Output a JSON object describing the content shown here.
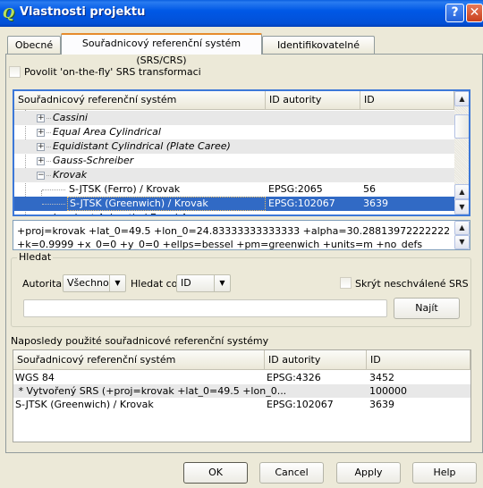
{
  "window": {
    "title": "Vlastnosti projektu",
    "help_button": "?",
    "close_button": "✕"
  },
  "tabs": [
    {
      "label": "Obecné",
      "active": false
    },
    {
      "label": "Souřadnicový referenční systém (SRS/CRS)",
      "active": true
    },
    {
      "label": "Identifikovatelné vrstvy",
      "active": false
    }
  ],
  "otf_checkbox": {
    "label": "Povolit 'on-the-fly' SRS transformaci",
    "checked": false
  },
  "crs_tree": {
    "columns": [
      "Souřadnicový referenční systém",
      "ID autority",
      "ID"
    ],
    "rows": [
      {
        "label": "Cassini",
        "type": "group",
        "expanded": false,
        "authority": "",
        "id": ""
      },
      {
        "label": "Equal Area Cylindrical",
        "type": "group",
        "expanded": false,
        "authority": "",
        "id": ""
      },
      {
        "label": "Equidistant Cylindrical (Plate Caree)",
        "type": "group",
        "expanded": false,
        "authority": "",
        "id": ""
      },
      {
        "label": "Gauss-Schreiber",
        "type": "group",
        "expanded": false,
        "authority": "",
        "id": ""
      },
      {
        "label": "Krovak",
        "type": "group",
        "expanded": true,
        "authority": "",
        "id": ""
      },
      {
        "label": "S-JTSK (Ferro) / Krovak",
        "type": "item",
        "authority": "EPSG:2065",
        "id": "56"
      },
      {
        "label": "S-JTSK (Greenwich) / Krovak",
        "type": "item",
        "selected": true,
        "authority": "EPSG:102067",
        "id": "3639"
      },
      {
        "label": "Lambert Azimuthal Equal Area",
        "type": "group",
        "expanded": false,
        "authority": "",
        "id": ""
      }
    ]
  },
  "proj_string": "+proj=krovak +lat_0=49.5 +lon_0=24.83333333333333 +alpha=30.28813972222222 +k=0.9999 +x_0=0 +y_0=0 +ellps=bessel +pm=greenwich +units=m +no_defs",
  "search": {
    "group_title": "Hledat",
    "authority_label": "Autorita",
    "authority_value": "Všechno",
    "search_for_label": "Hledat co",
    "search_for_value": "ID",
    "hide_deprecated_label": "Skrýt neschválené SRS",
    "hide_deprecated_checked": false,
    "input_value": "",
    "find_button": "Najít"
  },
  "recent": {
    "title": "Naposledy použité souřadnicové referenční systémy",
    "columns": [
      "Souřadnicový referenční systém",
      "ID autority",
      "ID"
    ],
    "rows": [
      {
        "label": "WGS 84",
        "authority": "EPSG:4326",
        "id": "3452"
      },
      {
        "label": " * Vytvořený SRS (+proj=krovak +lat_0=49.5 +lon_0...",
        "authority": "",
        "id": "100000"
      },
      {
        "label": "S-JTSK (Greenwich) / Krovak",
        "authority": "EPSG:102067",
        "id": "3639"
      }
    ]
  },
  "footer": {
    "ok": "OK",
    "cancel": "Cancel",
    "apply": "Apply",
    "help": "Help"
  },
  "colors": {
    "title_bar": "#0058e6",
    "selection": "#316ac5",
    "dialog_bg": "#ece9d8",
    "tab_accent": "#e68b2c"
  }
}
